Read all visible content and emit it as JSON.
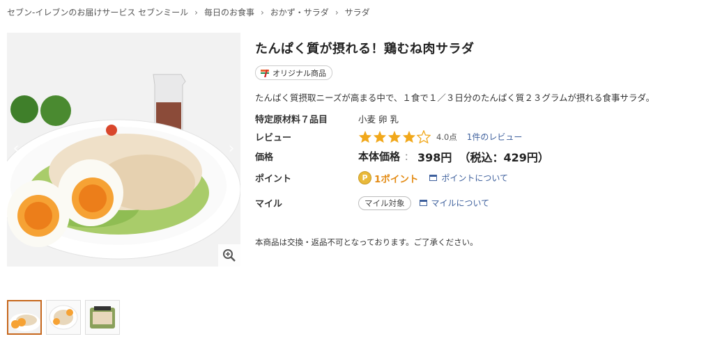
{
  "breadcrumb": [
    "セブン-イレブンのお届けサービス セブンミール",
    "毎日のお食事",
    "おかず・サラダ",
    "サラダ"
  ],
  "breadcrumb_sep": "›",
  "product": {
    "title": "たんぱく質が摂れる！鶏むね肉サラダ",
    "badge": "オリジナル商品",
    "description": "たんぱく質摂取ニーズが高まる中で、１食で１／３日分のたんぱく質２３グラムが摂れる食事サラダ。"
  },
  "details": {
    "allergen_label": "特定原材料７品目",
    "allergen_value": "小麦 卵 乳",
    "review_label": "レビュー",
    "rating": 4.0,
    "rating_text": "4.0点",
    "review_count_text": "1件のレビュー",
    "price_label": "価格",
    "price_base_label": "本体価格",
    "price_colon": "：",
    "price_base": "398円",
    "price_tax": "（税込：429円）",
    "point_label": "ポイント",
    "point_coin": "P",
    "point_value": "1ポイント",
    "point_link": "ポイントについて",
    "mile_label": "マイル",
    "mile_pill": "マイル対象",
    "mile_link": "マイルについて"
  },
  "notice": "本商品は交換・返品不可となっております。ご了承ください。",
  "colors": {
    "accent_orange": "#e38a12",
    "star": "#f1a81b",
    "link": "#3d5f9c",
    "thumb_active": "#c6661b"
  },
  "icons": {
    "prev": "chevron-left-icon",
    "next": "chevron-right-icon",
    "zoom": "zoom-in-icon"
  }
}
